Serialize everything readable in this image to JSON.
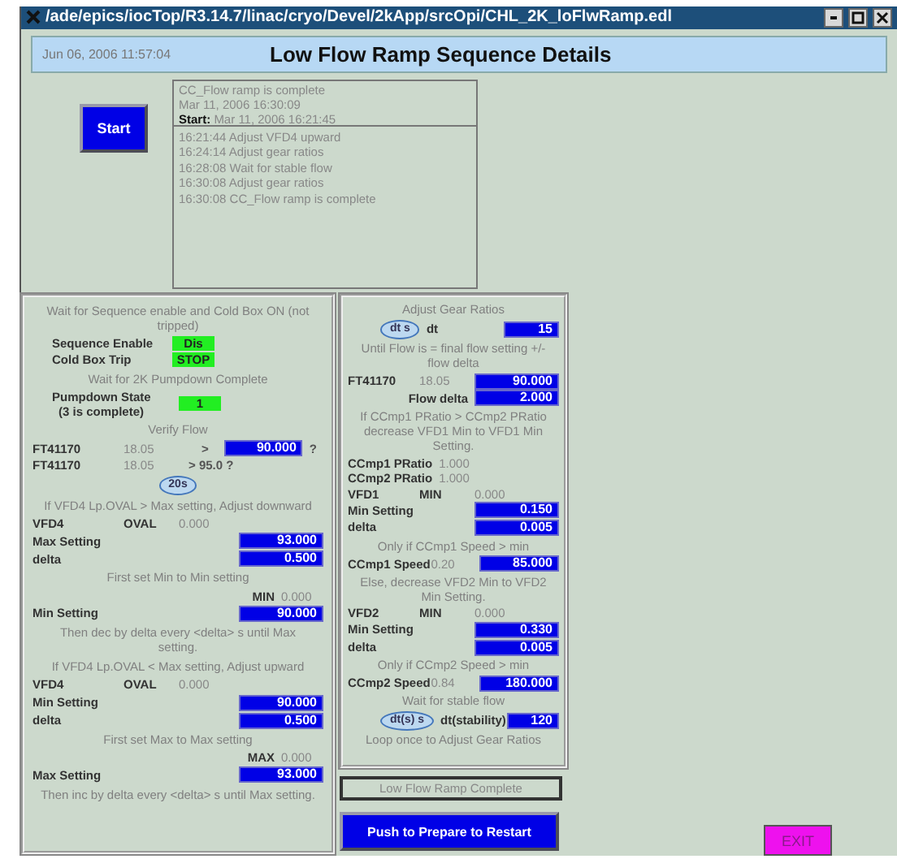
{
  "window": {
    "title": "/ade/epics/iocTop/R3.14.7/linac/cryo/Devel/2kApp/srcOpi/CHL_2K_loFlwRamp.edl"
  },
  "header": {
    "timestamp": "Jun 06, 2006 11:57:04",
    "title": "Low Flow Ramp Sequence Details"
  },
  "start_button": "Start",
  "summary": {
    "status": "CC_Flow ramp is complete",
    "time": "Mar 11, 2006 16:30:09",
    "start_label": "Start:",
    "start_time": "Mar 11, 2006 16:21:45"
  },
  "log": [
    "16:21:44 Adjust VFD4 upward",
    "16:24:14 Adjust gear ratios",
    "16:28:08 Wait for stable flow",
    "16:30:08 Adjust gear ratios",
    "16:30:08 CC_Flow ramp is complete"
  ],
  "left_panel": [
    {
      "kind": "note",
      "text": "Wait for Sequence enable and Cold Box ON (not tripped)"
    },
    {
      "kind": "status",
      "label": "Sequence Enable",
      "indicator": "Dis"
    },
    {
      "kind": "status",
      "label": "Cold Box Trip",
      "indicator": "STOP"
    },
    {
      "kind": "note",
      "text": "Wait for 2K Pumpdown Complete"
    },
    {
      "kind": "status",
      "label": "Pumpdown State",
      "sublabel": "(3 is complete)",
      "indicator": "1"
    },
    {
      "kind": "note",
      "text": "Verify Flow"
    },
    {
      "kind": "readout",
      "label": "FT41170",
      "value": "18.05",
      "op": ">",
      "entry": "90.000",
      "suffix": "?"
    },
    {
      "kind": "readout",
      "label": "FT41170",
      "value": "18.05",
      "op": "> 95.0 ?"
    },
    {
      "kind": "timer",
      "button": "20s"
    },
    {
      "kind": "note",
      "text": "If VFD4 Lp.OVAL > Max setting, Adjust downward"
    },
    {
      "kind": "readout",
      "label": "VFD4",
      "mid": "OVAL",
      "value": "0.000"
    },
    {
      "kind": "readout",
      "label": "Max Setting",
      "entry": "93.000"
    },
    {
      "kind": "readout",
      "label": "delta",
      "entry": "0.500"
    },
    {
      "kind": "note",
      "text": "First set Min to Min setting"
    },
    {
      "kind": "readout",
      "mid": "MIN",
      "value": "0.000"
    },
    {
      "kind": "readout",
      "label": "Min Setting",
      "entry": "90.000"
    },
    {
      "kind": "note",
      "text": "Then dec by delta every <delta> s until Max setting."
    },
    {
      "kind": "note",
      "text": "If VFD4 Lp.OVAL < Max setting, Adjust upward"
    },
    {
      "kind": "readout",
      "label": "VFD4",
      "mid": "OVAL",
      "value": "0.000"
    },
    {
      "kind": "readout",
      "label": "Min Setting",
      "entry": "90.000"
    },
    {
      "kind": "readout",
      "label": "delta",
      "entry": "0.500"
    },
    {
      "kind": "note",
      "text": "First set Max to Max setting"
    },
    {
      "kind": "readout",
      "mid": "MAX",
      "value": "0.000"
    },
    {
      "kind": "readout",
      "label": "Max Setting",
      "entry": "93.000"
    },
    {
      "kind": "note",
      "text": "Then inc by delta every <delta> s until Max setting."
    }
  ],
  "right_panel": [
    {
      "kind": "note",
      "text": "Adjust Gear Ratios"
    },
    {
      "kind": "timer",
      "button": "dt s",
      "label": "dt",
      "entry": "15"
    },
    {
      "kind": "note",
      "text": "Until Flow is = final flow setting +/- flow delta"
    },
    {
      "kind": "readout",
      "label": "FT41170",
      "value": "18.05",
      "entry": "90.000"
    },
    {
      "kind": "readout",
      "mid": "Flow delta",
      "entry": "2.000"
    },
    {
      "kind": "note",
      "text": "If CCmp1 PRatio > CCmp2 PRatio decrease VFD1 Min to VFD1 Min Setting."
    },
    {
      "kind": "readout",
      "label": "CCmp1 PRatio",
      "value": "1.000"
    },
    {
      "kind": "readout",
      "label": "CCmp2 PRatio",
      "value": "1.000"
    },
    {
      "kind": "readout",
      "label": "VFD1",
      "mid": "MIN",
      "value": "0.000"
    },
    {
      "kind": "readout",
      "label": "Min Setting",
      "entry": "0.150"
    },
    {
      "kind": "readout",
      "label": "delta",
      "entry": "0.005"
    },
    {
      "kind": "note",
      "text": "Only if CCmp1 Speed > min"
    },
    {
      "kind": "readout",
      "label": "CCmp1 Speed",
      "value": "0.20",
      "entry": "85.000"
    },
    {
      "kind": "note",
      "text": "Else, decrease VFD2 Min to VFD2 Min Setting."
    },
    {
      "kind": "readout",
      "label": "VFD2",
      "mid": "MIN",
      "value": "0.000"
    },
    {
      "kind": "readout",
      "label": "Min Setting",
      "entry": "0.330"
    },
    {
      "kind": "readout",
      "label": "delta",
      "entry": "0.005"
    },
    {
      "kind": "note",
      "text": "Only if CCmp2 Speed > min"
    },
    {
      "kind": "readout",
      "label": "CCmp2 Speed",
      "value": "0.84",
      "entry": "180.000"
    },
    {
      "kind": "note",
      "text": "Wait for stable flow"
    },
    {
      "kind": "timer",
      "button": "dt(s) s",
      "label": "dt(stability)",
      "entry": "120"
    },
    {
      "kind": "note",
      "text": "Loop once to Adjust Gear Ratios"
    }
  ],
  "ramp_status": "Low Flow Ramp Complete",
  "restart_button": "Push to Prepare to Restart",
  "exit_button": "EXIT"
}
